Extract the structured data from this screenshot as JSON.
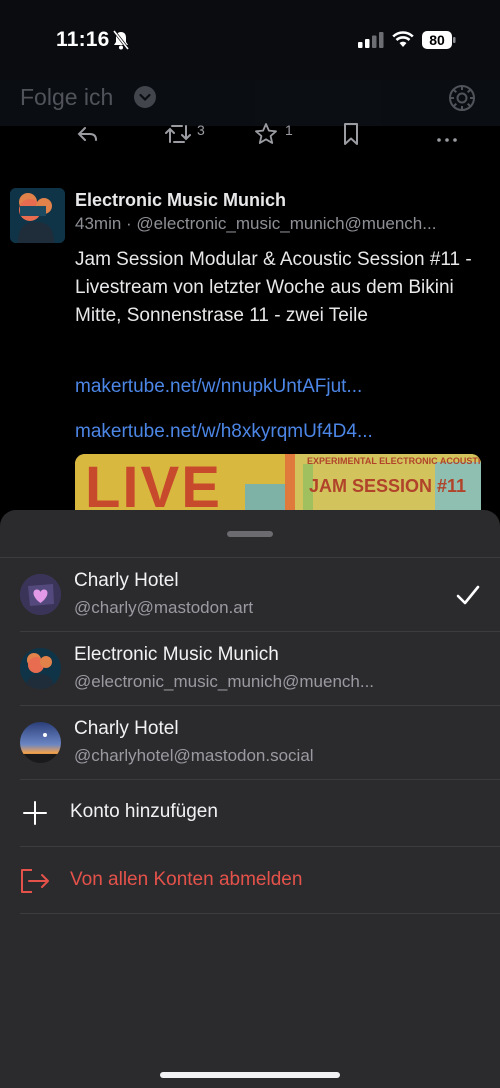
{
  "status_bar": {
    "time": "11:16",
    "battery": "80"
  },
  "header": {
    "title": "Folge ich"
  },
  "actions": {
    "boost_count": "3",
    "favorite_count": "1"
  },
  "post": {
    "author": "Electronic Music Munich",
    "meta": "43min · @electronic_music_munich@muench...",
    "body": "Jam Session Modular & Acoustic Session #11 - Livestream von letzter Woche aus dem Bikini Mitte, Sonnenstrase 11 - zwei Teile",
    "links": [
      "makertube.net/w/nnupkUntAFjut...",
      "makertube.net/w/h8xkyrqmUf4D4..."
    ],
    "image_text_big": "LIVE",
    "image_text_small": "EXPERIMENTAL ELECTRONIC ACOUSTIC",
    "image_text_title": "JAM SESSION #11"
  },
  "sheet": {
    "accounts": [
      {
        "name": "Charly Hotel",
        "handle": "@charly@mastodon.art",
        "selected": true
      },
      {
        "name": "Electronic Music Munich",
        "handle": "@electronic_music_munich@muench...",
        "selected": false
      },
      {
        "name": "Charly Hotel",
        "handle": "@charlyhotel@mastodon.social",
        "selected": false
      }
    ],
    "add_account": "Konto hinzufügen",
    "logout_all": "Von allen Konten abmelden"
  },
  "colors": {
    "link": "#4c86e6",
    "destructive": "#e5524a",
    "sheet_bg": "#2b2b2e"
  },
  "icons": {
    "status": [
      "bell-slash-icon",
      "signal-icon",
      "wifi-icon",
      "battery-icon"
    ],
    "actions": [
      "reply-icon",
      "boost-icon",
      "favorite-icon",
      "bookmark-icon",
      "more-icon"
    ],
    "sheet": [
      "checkmark-icon",
      "plus-icon",
      "logout-icon"
    ]
  }
}
